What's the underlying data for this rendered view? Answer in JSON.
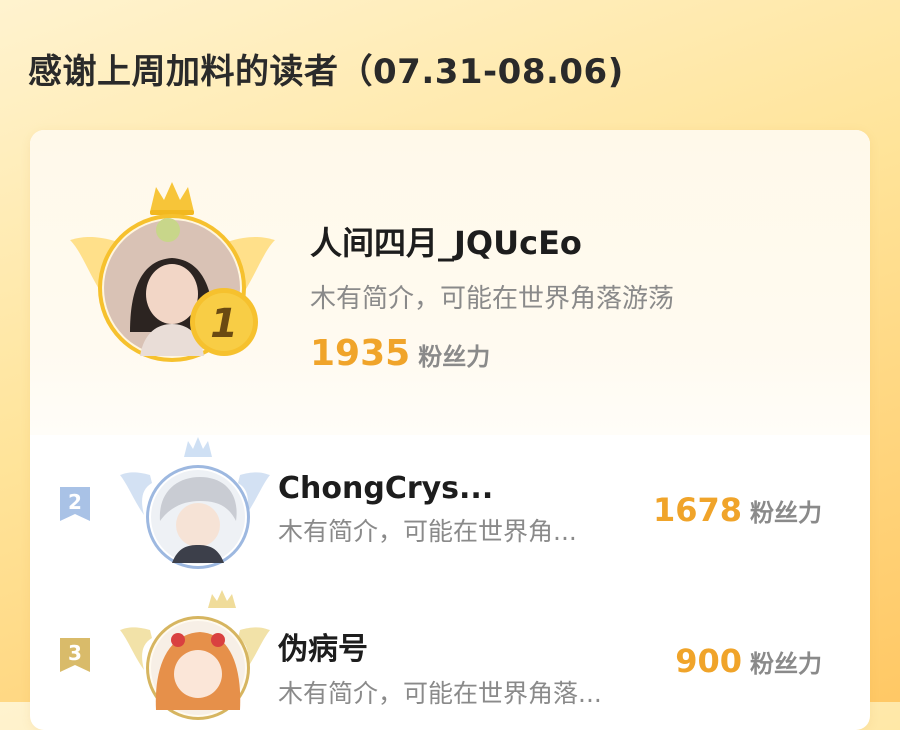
{
  "header": {
    "title": "感谢上周加料的读者（07.31-08.06)"
  },
  "leaderboard": {
    "score_unit": "粉丝力",
    "entries": [
      {
        "rank": "1",
        "name": "人间四月_JQUcEo",
        "bio": "木有简介，可能在世界角落游荡",
        "score": "1935"
      },
      {
        "rank": "2",
        "name": "ChongCrys...",
        "bio": "木有简介，可能在世界角...",
        "score": "1678"
      },
      {
        "rank": "3",
        "name": "伪病号",
        "bio": "木有简介，可能在世界角落...",
        "score": "900"
      }
    ]
  },
  "colors": {
    "accent": "#f0a42a",
    "gold": "#f6c12e",
    "silver": "#9db8e0",
    "bronze": "#d6b560"
  }
}
